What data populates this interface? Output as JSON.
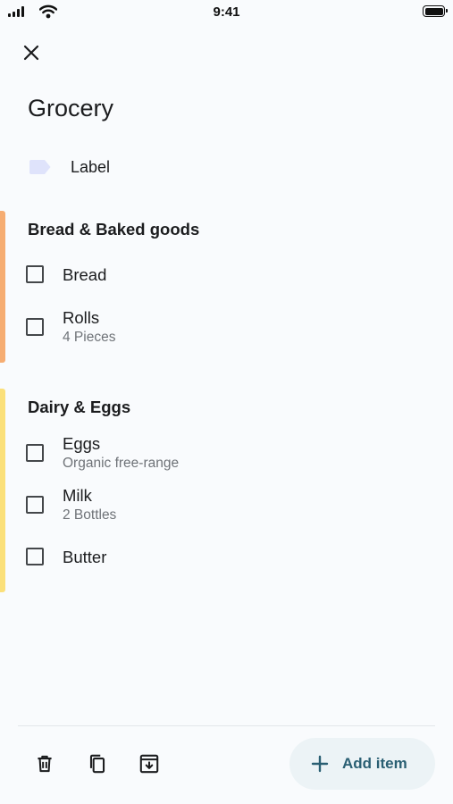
{
  "status": {
    "time": "9:41"
  },
  "note": {
    "title": "Grocery",
    "label": "Label",
    "label_color": "#dfe3fb"
  },
  "categories": [
    {
      "name": "Bread & Baked goods",
      "accent": "#f6ad72",
      "items": [
        {
          "name": "Bread",
          "detail": ""
        },
        {
          "name": "Rolls",
          "detail": "4 Pieces"
        }
      ]
    },
    {
      "name": "Dairy & Eggs",
      "accent": "#fbe07a",
      "items": [
        {
          "name": "Eggs",
          "detail": "Organic free-range"
        },
        {
          "name": "Milk",
          "detail": "2 Bottles"
        },
        {
          "name": "Butter",
          "detail": ""
        }
      ]
    }
  ],
  "toolbar": {
    "icons": [
      "delete-icon",
      "copy-icon",
      "archive-icon"
    ],
    "add_label": "Add item",
    "add_color": "#2a5f73"
  }
}
